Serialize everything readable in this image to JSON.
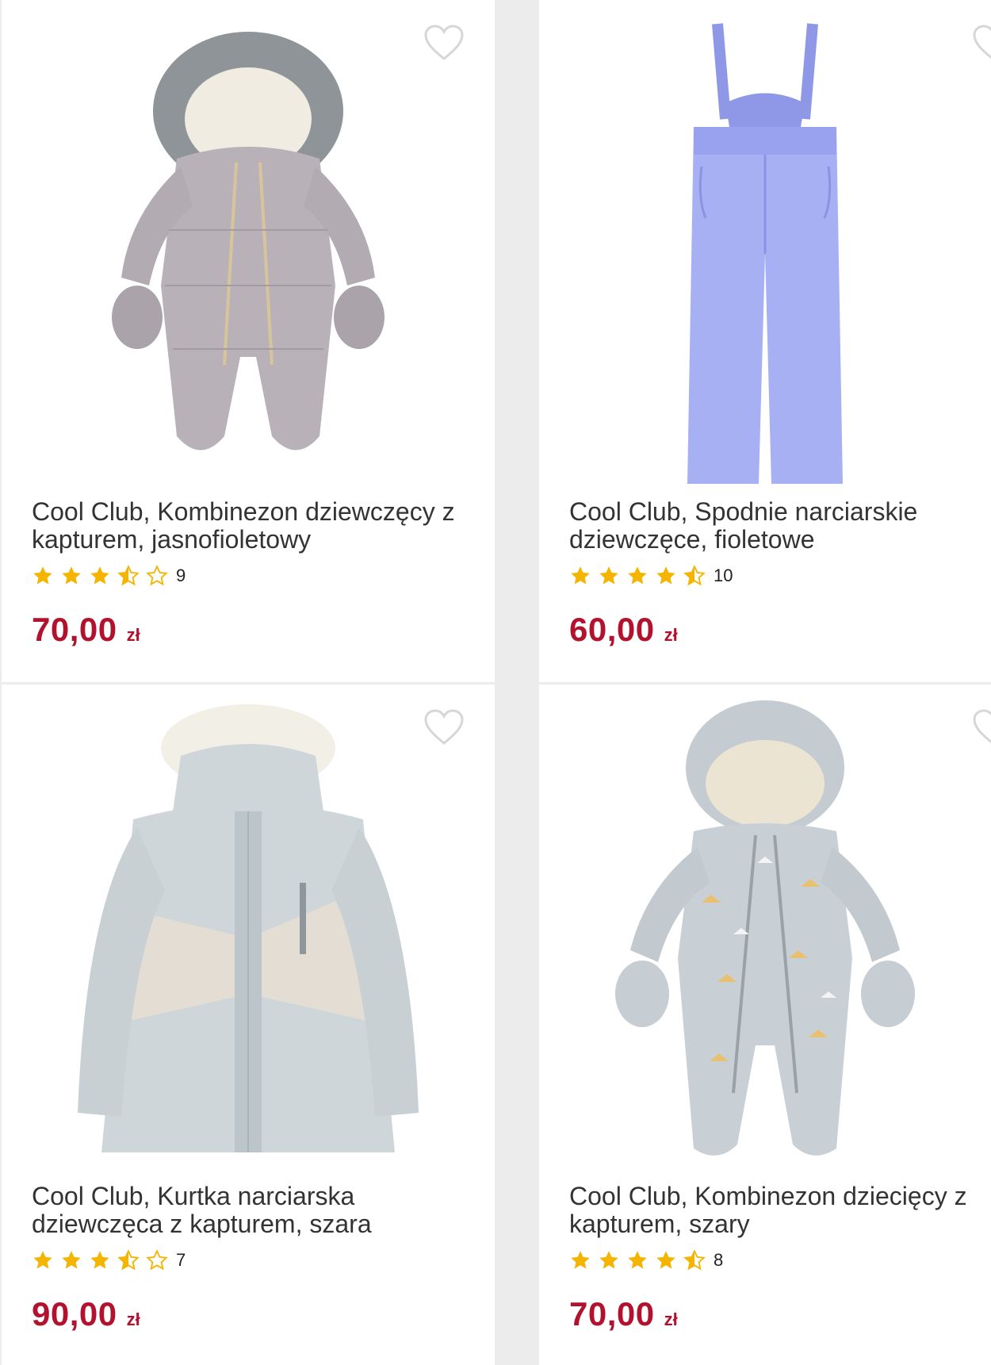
{
  "colors": {
    "accent_price": "#b2122d",
    "star": "#f4b400",
    "heart_outline": "#d6d6d6"
  },
  "products": [
    {
      "title": "Cool Club, Kombinezon dziewczęcy z kapturem, jasnofioletowy",
      "rating_stars": 3.5,
      "rating_count": "9",
      "price": "70,00",
      "currency": "zł",
      "image_icon": "pram-suit-image"
    },
    {
      "title": "Cool Club, Spodnie narciarskie dziewczęce, fioletowe",
      "rating_stars": 4.5,
      "rating_count": "10",
      "price": "60,00",
      "currency": "zł",
      "image_icon": "ski-pants-image"
    },
    {
      "title": "Cool Club, Kurtka narciarska dziewczęca z kapturem, szara",
      "rating_stars": 3.5,
      "rating_count": "7",
      "price": "90,00",
      "currency": "zł",
      "image_icon": "ski-jacket-image"
    },
    {
      "title": "Cool Club, Kombinezon dziecięcy z kapturem, szary",
      "rating_stars": 4.5,
      "rating_count": "8",
      "price": "70,00",
      "currency": "zł",
      "image_icon": "baby-snowsuit-image"
    }
  ]
}
